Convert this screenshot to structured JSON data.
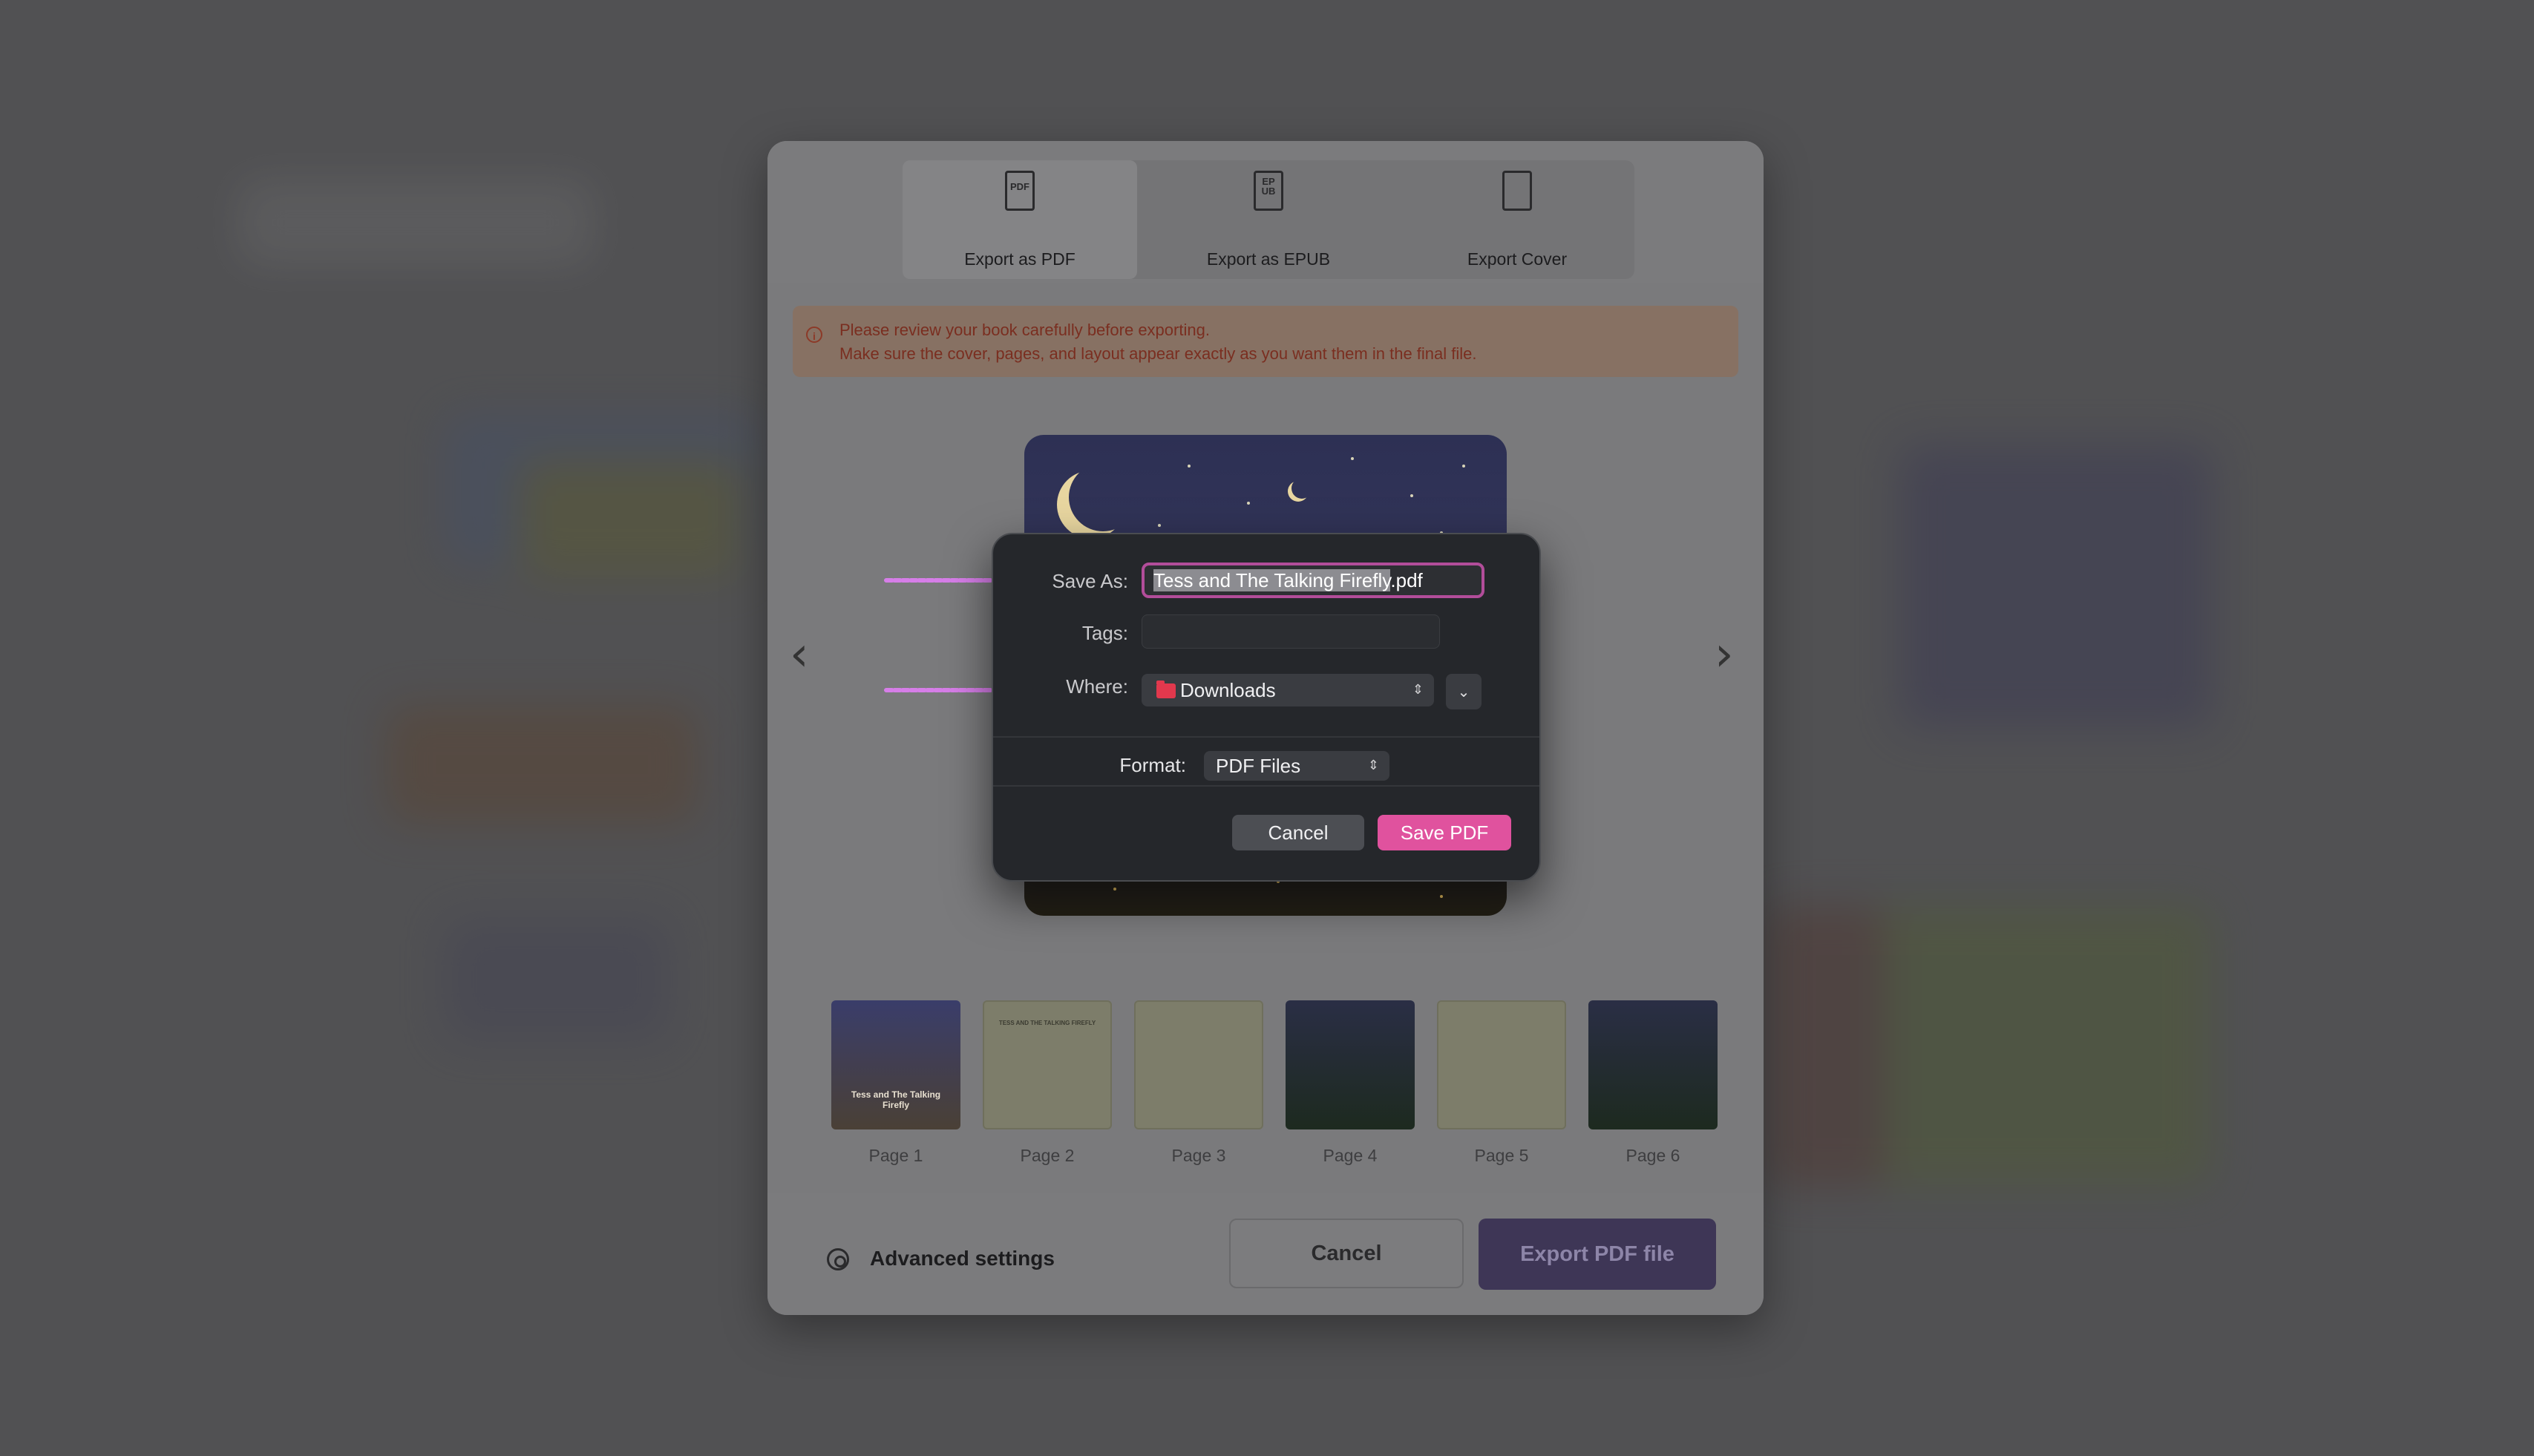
{
  "export_tabs": [
    {
      "label": "Export as PDF",
      "icon": "pdf-file-icon",
      "glyph": "PDF",
      "active": true
    },
    {
      "label": "Export as EPUB",
      "icon": "epub-file-icon",
      "glyph": "EP UB",
      "active": false
    },
    {
      "label": "Export Cover",
      "icon": "cover-file-icon",
      "glyph": "",
      "active": false
    }
  ],
  "alert": {
    "line1": "Please review your book carefully before exporting.",
    "line2": "Make sure the cover, pages, and layout appear exactly as you want them in the final file.",
    "icon": "info-icon"
  },
  "thumbnails": [
    {
      "label": "Page 1",
      "style": "cover",
      "text": "Tess and The Talking Firefly"
    },
    {
      "label": "Page 2",
      "style": "cream",
      "text": "TESS AND THE TALKING FIREFLY"
    },
    {
      "label": "Page 3",
      "style": "cream",
      "text": ""
    },
    {
      "label": "Page 4",
      "style": "night",
      "text": ""
    },
    {
      "label": "Page 5",
      "style": "cream",
      "text": ""
    },
    {
      "label": "Page 6",
      "style": "night",
      "text": ""
    }
  ],
  "footer": {
    "advanced_label": "Advanced settings",
    "cancel_label": "Cancel",
    "export_label": "Export PDF file"
  },
  "save_dialog": {
    "save_as_label": "Save As:",
    "filename_selected": "Tess and The Talking Firefly",
    "filename_ext": ".pdf",
    "tags_label": "Tags:",
    "tags_value": "",
    "where_label": "Where:",
    "where_value": "Downloads",
    "format_label": "Format:",
    "format_value": "PDF Files",
    "cancel_label": "Cancel",
    "save_label": "Save PDF"
  },
  "colors": {
    "accent_pink": "#e0529e",
    "field_focus": "#b24d9a",
    "annotation_arrow": "#d67ee8",
    "export_button": "#3e3656"
  }
}
